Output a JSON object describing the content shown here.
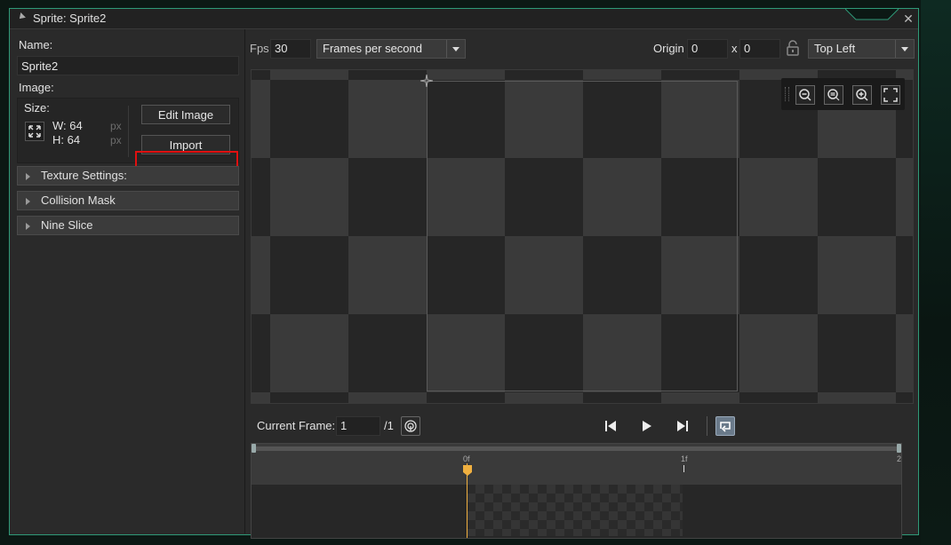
{
  "window": {
    "title": "Sprite: Sprite2",
    "close_glyph": "✕",
    "accent": "#2f9a78"
  },
  "left": {
    "name_label": "Name:",
    "name_value": "Sprite2",
    "image_label": "Image:",
    "size_label": "Size:",
    "width": "W: 64",
    "height": "H: 64",
    "unit": "px",
    "edit_image_button": "Edit Image",
    "import_button": "Import",
    "sections": [
      {
        "label": "Texture Settings:"
      },
      {
        "label": "Collision Mask"
      },
      {
        "label": "Nine Slice"
      }
    ]
  },
  "toolbar": {
    "fps_label": "Fps",
    "fps_value": "30",
    "fps_mode": "Frames per second",
    "origin_label": "Origin",
    "origin_x": "0",
    "x_sep": "x",
    "origin_y": "0",
    "origin_preset": "Top Left"
  },
  "canvas": {
    "zoom_icons": [
      "zoom-out-icon",
      "zoom-reset-icon",
      "zoom-in-icon",
      "fit-screen-icon"
    ]
  },
  "playback": {
    "current_frame_label": "Current Frame:",
    "current_frame_value": "1",
    "frame_total": "/1"
  },
  "timeline": {
    "ticks": [
      "0f",
      "1f",
      "2"
    ]
  }
}
